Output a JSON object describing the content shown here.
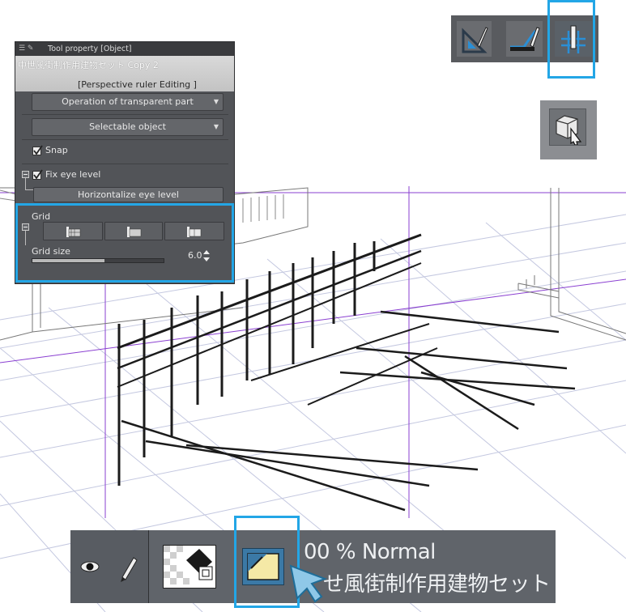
{
  "tool_property": {
    "header_title": "Tool property [Object]",
    "object_name": "中世風街制作用建物セット Copy 2",
    "mode_label": "[Perspective ruler Editing ]",
    "transparent_dropdown": "Operation of transparent part",
    "selectable_dropdown": "Selectable object",
    "snap_label": "Snap",
    "snap_checked": true,
    "fix_eye_level_label": "Fix eye level",
    "fix_eye_level_checked": true,
    "horizontalize_button": "Horizontalize eye level",
    "grid_label": "Grid",
    "grid_size_label": "Grid size",
    "grid_size_value": "6.0",
    "grid_size_fraction": 0.55
  },
  "top_icons": [
    "perspective-ruler-icon",
    "ruler-curve-icon",
    "grid-ruler-icon"
  ],
  "object_tool_icon": "3d-object-select-icon",
  "layer": {
    "opacity_blend": "00 % Normal",
    "name": "せ風街制作用建物セット"
  },
  "colors": {
    "highlight": "#23a6e6",
    "panel_bg": "#525458",
    "guide_purple": "#8a3fd1",
    "grid_lines": "#b9bdd8"
  }
}
